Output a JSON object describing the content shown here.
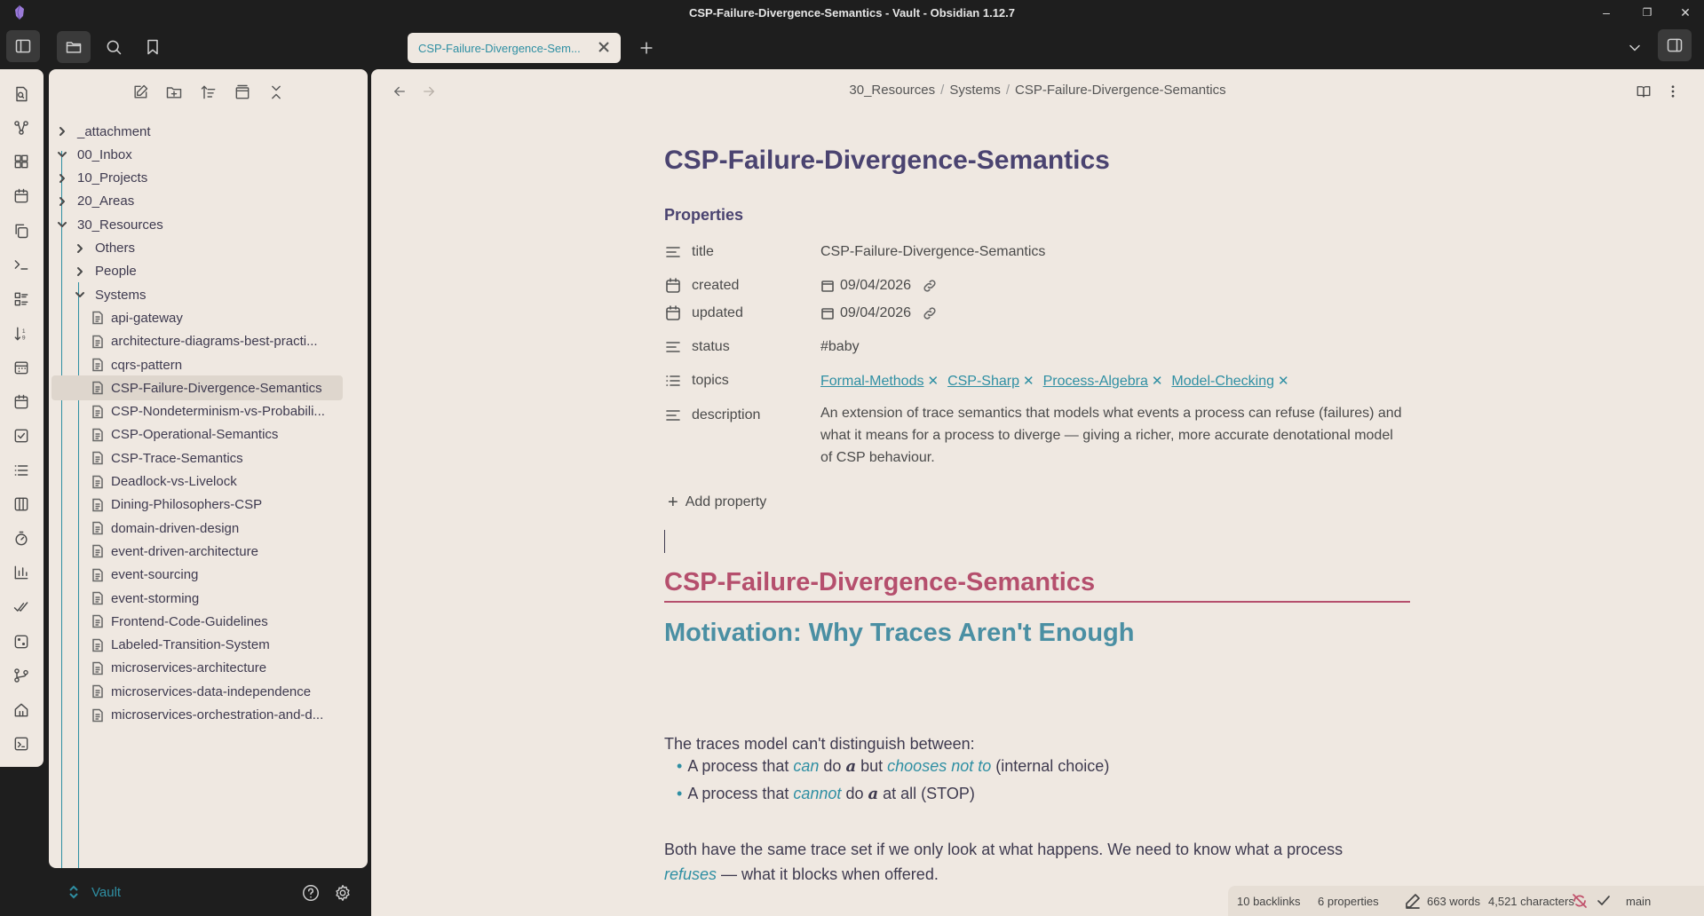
{
  "window": {
    "title": "CSP-Failure-Divergence-Semantics - Vault - Obsidian 1.12.7",
    "controls": {
      "minimize": "–",
      "restore": "❐",
      "close": "✕"
    }
  },
  "tabs": [
    {
      "label": "CSP-Failure-Divergence-Sem...",
      "active": true
    }
  ],
  "breadcrumb": [
    "30_Resources",
    "Systems",
    "CSP-Failure-Divergence-Semantics"
  ],
  "sidebar": {
    "tree": [
      {
        "label": "_attachment",
        "type": "folder",
        "expanded": false,
        "depth": 0
      },
      {
        "label": "00_Inbox",
        "type": "folder",
        "expanded": true,
        "depth": 0
      },
      {
        "label": "10_Projects",
        "type": "folder",
        "expanded": false,
        "depth": 0
      },
      {
        "label": "20_Areas",
        "type": "folder",
        "expanded": false,
        "depth": 0
      },
      {
        "label": "30_Resources",
        "type": "folder",
        "expanded": true,
        "depth": 0
      },
      {
        "label": "Others",
        "type": "folder",
        "expanded": false,
        "depth": 1
      },
      {
        "label": "People",
        "type": "folder",
        "expanded": false,
        "depth": 1
      },
      {
        "label": "Systems",
        "type": "folder",
        "expanded": true,
        "depth": 1
      },
      {
        "label": "api-gateway",
        "type": "file",
        "depth": 2
      },
      {
        "label": "architecture-diagrams-best-practi...",
        "type": "file",
        "depth": 2
      },
      {
        "label": "cqrs-pattern",
        "type": "file",
        "depth": 2
      },
      {
        "label": "CSP-Failure-Divergence-Semantics",
        "type": "file",
        "depth": 2,
        "selected": true
      },
      {
        "label": "CSP-Nondeterminism-vs-Probabili...",
        "type": "file",
        "depth": 2
      },
      {
        "label": "CSP-Operational-Semantics",
        "type": "file",
        "depth": 2
      },
      {
        "label": "CSP-Trace-Semantics",
        "type": "file",
        "depth": 2
      },
      {
        "label": "Deadlock-vs-Livelock",
        "type": "file",
        "depth": 2
      },
      {
        "label": "Dining-Philosophers-CSP",
        "type": "file",
        "depth": 2
      },
      {
        "label": "domain-driven-design",
        "type": "file",
        "depth": 2
      },
      {
        "label": "event-driven-architecture",
        "type": "file",
        "depth": 2
      },
      {
        "label": "event-sourcing",
        "type": "file",
        "depth": 2
      },
      {
        "label": "event-storming",
        "type": "file",
        "depth": 2
      },
      {
        "label": "Frontend-Code-Guidelines",
        "type": "file",
        "depth": 2
      },
      {
        "label": "Labeled-Transition-System",
        "type": "file",
        "depth": 2
      },
      {
        "label": "microservices-architecture",
        "type": "file",
        "depth": 2
      },
      {
        "label": "microservices-data-independence",
        "type": "file",
        "depth": 2
      },
      {
        "label": "microservices-orchestration-and-d...",
        "type": "file",
        "depth": 2
      }
    ],
    "vault_name": "Vault"
  },
  "note": {
    "title": "CSP-Failure-Divergence-Semantics",
    "properties_heading": "Properties",
    "properties": {
      "title": {
        "key": "title",
        "value": "CSP-Failure-Divergence-Semantics"
      },
      "created": {
        "key": "created",
        "value": "09/04/2026"
      },
      "updated": {
        "key": "updated",
        "value": "09/04/2026"
      },
      "status": {
        "key": "status",
        "value": "#baby"
      },
      "topics": {
        "key": "topics",
        "values": [
          "Formal-Methods",
          "CSP-Sharp",
          "Process-Algebra",
          "Model-Checking"
        ]
      },
      "description": {
        "key": "description",
        "value": "An extension of trace semantics that models what events a process can refuse (failures) and what it means for a process to diverge — giving a richer, more accurate denotational model of CSP behaviour."
      }
    },
    "add_property": "Add property",
    "h1": "CSP-Failure-Divergence-Semantics",
    "h2": "Motivation: Why Traces Aren't Enough",
    "intro": "The traces model can't distinguish between:",
    "bullet1": {
      "a": "A process that ",
      "b": "can",
      "c": " do ",
      "d": "a",
      "e": " but ",
      "f": "chooses not to",
      "g": " (internal choice)"
    },
    "bullet2": {
      "a": "A process that ",
      "b": "cannot",
      "c": " do ",
      "d": "a",
      "e": " at all (STOP)"
    },
    "para2": {
      "a": "Both have the same trace set if we only look at what happens. We need to know what a process",
      "b": "refuses",
      "c": " — what it blocks when offered."
    }
  },
  "statusbar": {
    "backlinks": "10 backlinks",
    "properties": "6 properties",
    "words": "663 words",
    "characters": "4,521 characters",
    "branch": "main"
  },
  "colors": {
    "accent": "#2f8fa3",
    "h1": "#b54f6d",
    "h2": "#4a8fa3",
    "title": "#4a4370",
    "background": "#efe8e1",
    "chrome": "#1e1e1e"
  }
}
